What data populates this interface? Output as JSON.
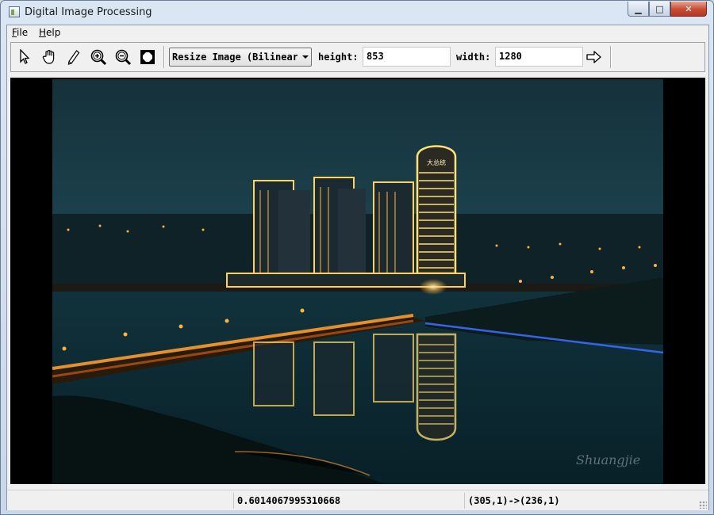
{
  "window": {
    "title": "Digital Image Processing",
    "controls": {
      "minimize": "▁",
      "maximize": "□",
      "close": "✕"
    }
  },
  "menu": {
    "file": {
      "mnemonic": "F",
      "rest": "ile"
    },
    "help": {
      "mnemonic": "H",
      "rest": "elp"
    }
  },
  "toolbar": {
    "tools": [
      "pointer-icon",
      "hand-icon",
      "pencil-icon",
      "zoom-in-icon",
      "zoom-out-icon",
      "fit-screen-icon"
    ],
    "operation": "Resize Image (Bilinear)",
    "height_label": "height:",
    "height_value": "853",
    "width_label": "width:",
    "width_value": "1280",
    "apply_icon": "arrow-right-icon"
  },
  "image": {
    "watermark": "Shuangjie",
    "tower_sign": "大总统"
  },
  "status": {
    "value": "0.6014067995310668",
    "mapping": "(305,1)->(236,1)"
  },
  "colors": {
    "sky_top": "#17353c",
    "sky_bottom": "#1f4a56",
    "water": "#0e2c35",
    "lights": "#ffb236",
    "tower_lights": "#ffe07a"
  }
}
